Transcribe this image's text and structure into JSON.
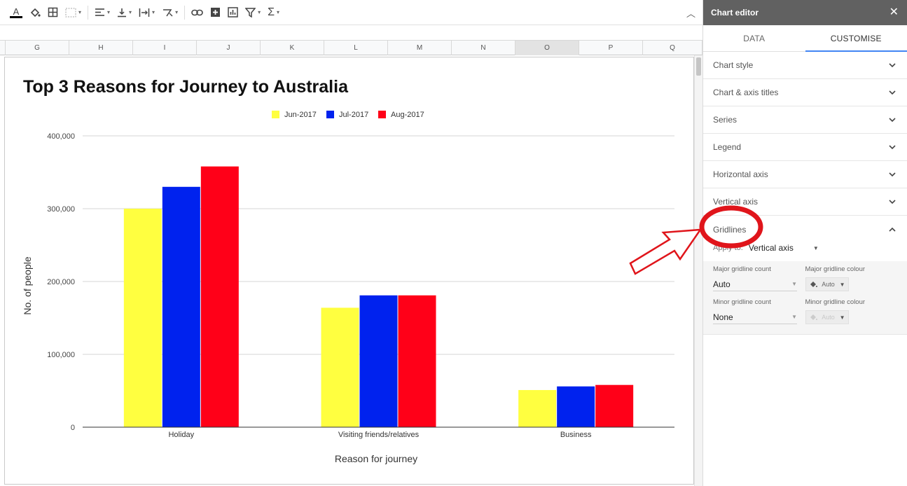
{
  "toolbar": {
    "items": [
      "text-color",
      "fill-color",
      "borders",
      "merge",
      "align",
      "valign",
      "wrap",
      "rotate",
      "link",
      "comment",
      "chart",
      "filter",
      "functions"
    ]
  },
  "columns": [
    "G",
    "H",
    "I",
    "J",
    "K",
    "L",
    "M",
    "N",
    "O",
    "P",
    "Q"
  ],
  "selected_column": "O",
  "chart_data": {
    "type": "bar",
    "title": "Top 3 Reasons for Journey to Australia",
    "xlabel": "Reason for journey",
    "ylabel": "No. of people",
    "categories": [
      "Holiday",
      "Visiting friends/relatives",
      "Business"
    ],
    "series": [
      {
        "name": "Jun-2017",
        "color": "#ffff40",
        "values": [
          300000,
          164000,
          51000
        ]
      },
      {
        "name": "Jul-2017",
        "color": "#0022ee",
        "values": [
          330000,
          181000,
          56000
        ]
      },
      {
        "name": "Aug-2017",
        "color": "#ff0018",
        "values": [
          358000,
          181000,
          58000
        ]
      }
    ],
    "ylim": [
      0,
      400000
    ],
    "yticks": [
      0,
      100000,
      200000,
      300000,
      400000
    ],
    "ytick_labels": [
      "0",
      "100,000",
      "200,000",
      "300,000",
      "400,000"
    ],
    "grid": true,
    "legend": "top"
  },
  "panel": {
    "title": "Chart editor",
    "close": "✕",
    "tabs": [
      "DATA",
      "CUSTOMISE"
    ],
    "active_tab": "CUSTOMISE",
    "sections": [
      "Chart style",
      "Chart & axis titles",
      "Series",
      "Legend",
      "Horizontal axis",
      "Vertical axis"
    ],
    "gridlines": {
      "title": "Gridlines",
      "apply_label": "Apply to:",
      "apply_value": "Vertical axis",
      "major_count_label": "Major gridline count",
      "major_count_value": "Auto",
      "major_colour_label": "Major gridline colour",
      "major_colour_value": "Auto",
      "minor_count_label": "Minor gridline count",
      "minor_count_value": "None",
      "minor_colour_label": "Minor gridline colour",
      "minor_colour_value": "Auto"
    }
  },
  "annotation": {
    "color": "#e0151b"
  }
}
